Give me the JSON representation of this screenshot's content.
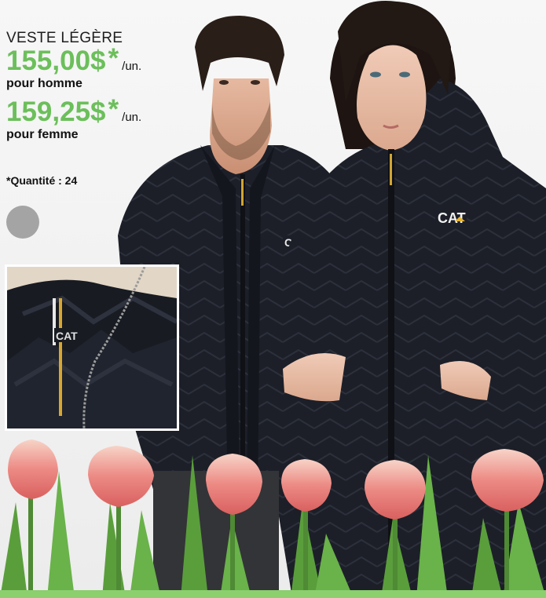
{
  "product": {
    "name": "VESTE LÉGÈRE",
    "men": {
      "price": "155,00$",
      "asterisk": "*",
      "unit": "/un.",
      "label": "pour homme"
    },
    "women": {
      "price": "159,25$",
      "asterisk": "*",
      "unit": "/un.",
      "label": "pour femme"
    },
    "quantity_note": "*Quantité : 24"
  },
  "logos": {
    "brand_text": "CAT"
  },
  "colors": {
    "price_green": "#6cbf5b",
    "jacket_black": "#1b1e27",
    "swatch_gray": "#a4a4a4",
    "tulip_pink": "#e8706d",
    "leaf_green": "#5a9e3c",
    "band_green": "#8bcf6e"
  },
  "swatch": {
    "color_name": "gray-color-swatch"
  }
}
